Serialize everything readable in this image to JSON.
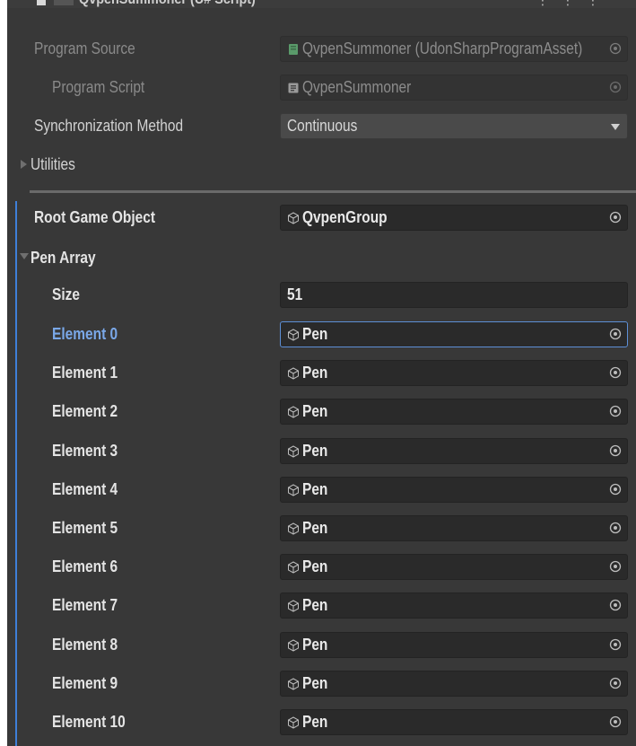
{
  "header": {
    "title": "QvpenSummoner (U# Script)"
  },
  "program_source": {
    "label": "Program Source",
    "value": "QvpenSummoner (UdonSharpProgramAsset)",
    "icon": "udonsharp-asset-icon",
    "icon_color": "#5a9a6a"
  },
  "program_script": {
    "label": "Program Script",
    "value": "QvpenSummoner",
    "icon": "script-icon"
  },
  "sync_method": {
    "label": "Synchronization Method",
    "value": "Continuous"
  },
  "utilities": {
    "label": "Utilities"
  },
  "root_game_object": {
    "label": "Root Game Object",
    "value": "QvpenGroup",
    "icon": "gameobject-cube-icon"
  },
  "pen_array": {
    "label": "Pen Array",
    "size_label": "Size",
    "size_value": "51",
    "elements": [
      {
        "label": "Element 0",
        "value": "Pen"
      },
      {
        "label": "Element 1",
        "value": "Pen"
      },
      {
        "label": "Element 2",
        "value": "Pen"
      },
      {
        "label": "Element 3",
        "value": "Pen"
      },
      {
        "label": "Element 4",
        "value": "Pen"
      },
      {
        "label": "Element 5",
        "value": "Pen"
      },
      {
        "label": "Element 6",
        "value": "Pen"
      },
      {
        "label": "Element 7",
        "value": "Pen"
      },
      {
        "label": "Element 8",
        "value": "Pen"
      },
      {
        "label": "Element 9",
        "value": "Pen"
      },
      {
        "label": "Element 10",
        "value": "Pen"
      }
    ]
  },
  "colors": {
    "panel_bg": "#383838",
    "field_bg": "#2a2a2a",
    "selection_accent": "#3f7fd8",
    "active_label": "#7aa8e8"
  }
}
